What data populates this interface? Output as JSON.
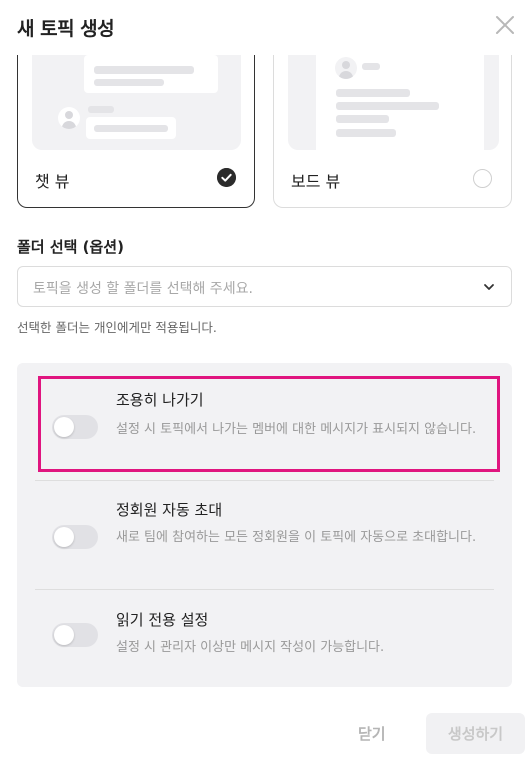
{
  "dialog": {
    "title": "새 토픽 생성"
  },
  "views": [
    {
      "label": "챗 뷰",
      "selected": true
    },
    {
      "label": "보드 뷰",
      "selected": false
    }
  ],
  "folder": {
    "label": "폴더 선택 (옵션)",
    "placeholder": "토픽을 생성 할 폴더를 선택해 주세요.",
    "helper": "선택한 폴더는 개인에게만 적용됩니다."
  },
  "settings": [
    {
      "title": "조용히 나가기",
      "desc": "설정 시 토픽에서 나가는 멤버에 대한 메시지가 표시되지 않습니다.",
      "on": false
    },
    {
      "title": "정회원 자동 초대",
      "desc": "새로 팀에 참여하는 모든 정회원을 이 토픽에 자동으로 초대합니다.",
      "on": false
    },
    {
      "title": "읽기 전용 설정",
      "desc": "설정 시 관리자 이상만 메시지 작성이 가능합니다.",
      "on": false
    }
  ],
  "footer": {
    "close_label": "닫기",
    "create_label": "생성하기"
  },
  "colors": {
    "highlight": "#e0157f",
    "panel_bg": "#f2f2f4",
    "check": "#2b2b2b"
  },
  "icons": [
    "close-icon",
    "checkmark-icon",
    "chevron-down-icon"
  ]
}
